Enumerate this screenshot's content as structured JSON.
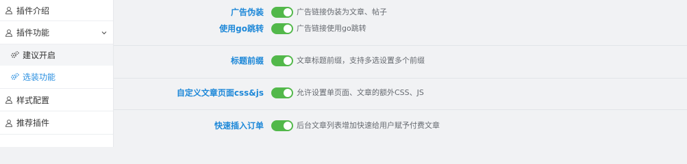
{
  "sidebar": {
    "items": [
      {
        "label": "插件介绍",
        "icon": "user-icon"
      },
      {
        "label": "插件功能",
        "icon": "user-icon",
        "chevron": "chevron-down-icon"
      },
      {
        "label": "样式配置",
        "icon": "user-icon"
      },
      {
        "label": "推荐插件",
        "icon": "user-icon"
      }
    ],
    "subitems": [
      {
        "label": "建议开启",
        "icon": "gears-icon",
        "active": false
      },
      {
        "label": "选装功能",
        "icon": "gears-icon",
        "active": true
      }
    ]
  },
  "options": [
    {
      "label": "广告伪装",
      "desc": "广告链接伪装为文章、帖子",
      "enabled": true
    },
    {
      "label": "使用go跳转",
      "desc": "广告链接使用go跳转",
      "enabled": true
    },
    {
      "label": "标题前缀",
      "desc": "文章标题前缀，支持多选设置多个前缀",
      "enabled": true
    },
    {
      "label": "自定义文章页面css&js",
      "desc": "允许设置单页面、文章的额外CSS、JS",
      "enabled": true
    },
    {
      "label": "快速插入订单",
      "desc": "后台文章列表增加快速给用户赋予付费文章",
      "enabled": true
    }
  ],
  "colors": {
    "accent": "#1e88d8",
    "toggle_on": "#52b84a",
    "active_nav": "#2a8fe0"
  }
}
